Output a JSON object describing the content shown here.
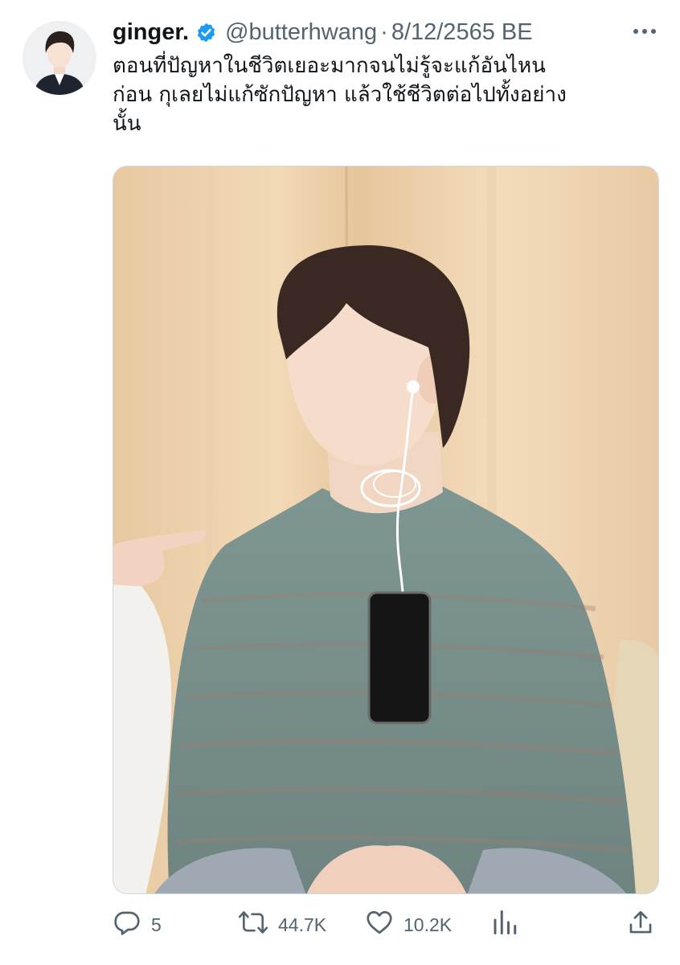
{
  "tweet": {
    "display_name": "ginger.",
    "handle": "@butterhwang",
    "separator": "·",
    "date": "8/12/2565 BE",
    "text": "ตอนที่ปัญหาในชีวิตเยอะมากจนไม่รู้จะแก้อันไหน\nก่อน กุเลยไม่แก้ซักปัญหา แล้วใช้ชีวิตต่อไปทั้งอย่าง\nนั้น"
  },
  "actions": {
    "replies": "5",
    "retweets": "44.7K",
    "likes": "10.2K"
  },
  "icons": {
    "verified": "verified-badge-icon",
    "more": "more-options-icon",
    "reply": "reply-icon",
    "retweet": "retweet-icon",
    "like": "heart-icon",
    "views": "analytics-icon",
    "share": "share-icon"
  },
  "colors": {
    "text": "#0f1419",
    "secondary": "#536471",
    "verified": "#1d9bf0"
  }
}
